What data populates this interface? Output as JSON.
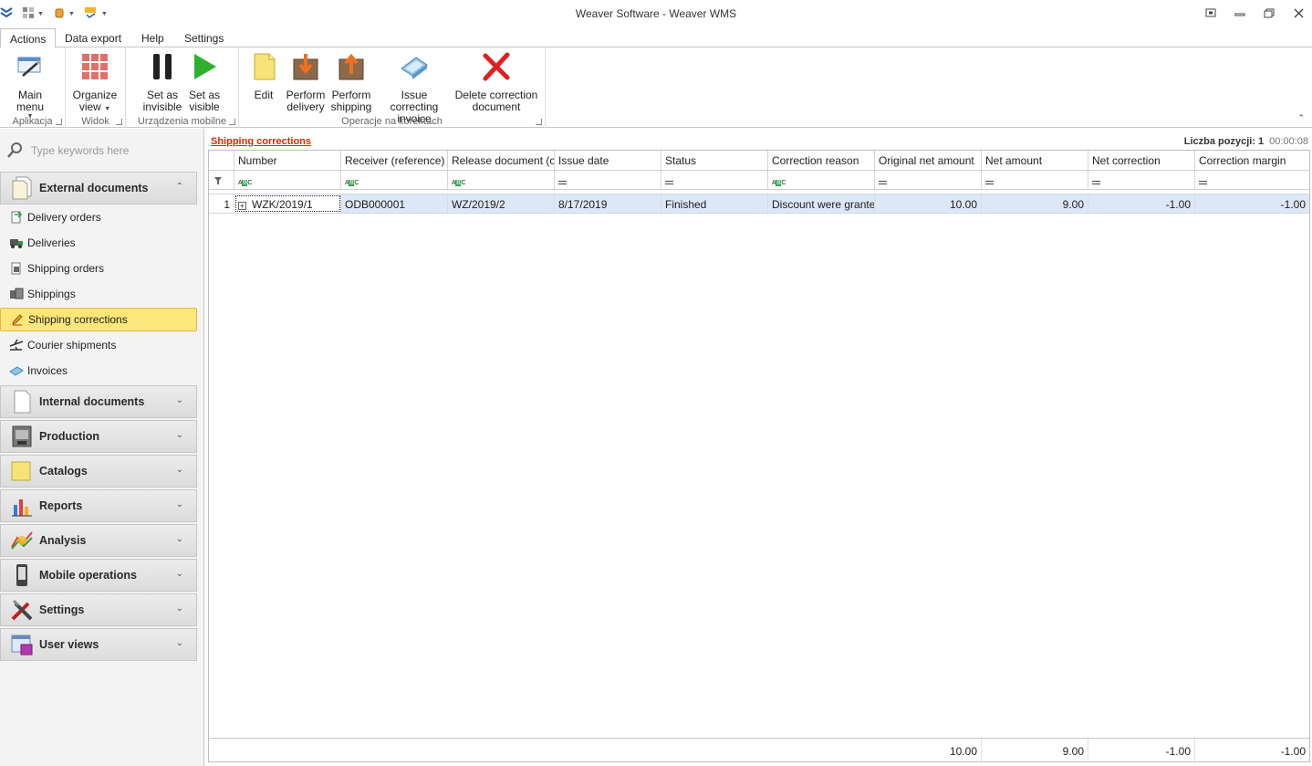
{
  "window": {
    "title": "Weaver Software - Weaver WMS"
  },
  "ribbon_tabs": [
    "Actions",
    "Data export",
    "Help",
    "Settings"
  ],
  "ribbon": {
    "groups": [
      {
        "label": "Aplikacja",
        "buttons": [
          {
            "label1": "Main menu",
            "label2": "",
            "icon": "main-menu-icon",
            "dropdown": true
          }
        ]
      },
      {
        "label": "Widok",
        "buttons": [
          {
            "label1": "Organize",
            "label2": "view",
            "icon": "organize-view-icon",
            "dropdown": true
          }
        ]
      },
      {
        "label": "Urządzenia mobilne",
        "buttons": [
          {
            "label1": "Set as",
            "label2": "invisible",
            "icon": "pause-icon"
          },
          {
            "label1": "Set as",
            "label2": "visible",
            "icon": "play-icon"
          }
        ]
      },
      {
        "label": "Operacje na korektach",
        "buttons": [
          {
            "label1": "Edit",
            "label2": "",
            "icon": "edit-icon"
          },
          {
            "label1": "Perform",
            "label2": "delivery",
            "icon": "perform-delivery-icon"
          },
          {
            "label1": "Perform",
            "label2": "shipping",
            "icon": "perform-shipping-icon"
          },
          {
            "label1": "Issue correcting",
            "label2": "invoice",
            "icon": "issue-invoice-icon"
          },
          {
            "label1": "Delete correction",
            "label2": "document",
            "icon": "delete-icon"
          }
        ]
      }
    ]
  },
  "nav": {
    "search_placeholder": "Type keywords here",
    "external_group": "External documents",
    "external_items": [
      "Delivery orders",
      "Deliveries",
      "Shipping orders",
      "Shippings",
      "Shipping corrections",
      "Courier shipments",
      "Invoices"
    ],
    "selected_item": "Shipping corrections",
    "groups": [
      "Internal documents",
      "Production",
      "Catalogs",
      "Reports",
      "Analysis",
      "Mobile operations",
      "Settings",
      "User views"
    ]
  },
  "content": {
    "title": "Shipping corrections",
    "count_label": "Liczba pozycji: 1",
    "timer": "00:00:08"
  },
  "grid": {
    "columns": [
      "Number",
      "Receiver (reference)",
      "Release document (c...",
      "Issue date",
      "Status",
      "Correction reason",
      "Original net amount",
      "Net amount",
      "Net correction",
      "Correction margin"
    ],
    "rows": [
      {
        "row_number": "1",
        "number": "WZK/2019/1",
        "receiver": "ODB000001",
        "release_document": "WZ/2019/2",
        "issue_date": "8/17/2019",
        "status": "Finished",
        "correction_reason": "Discount were granted",
        "original_net_amount": "10.00",
        "net_amount": "9.00",
        "net_correction": "-1.00",
        "correction_margin": "-1.00"
      }
    ],
    "totals": {
      "original_net_amount": "10.00",
      "net_amount": "9.00",
      "net_correction": "-1.00",
      "correction_margin": "-1.00"
    }
  },
  "colors": {
    "selection": "#fde67a",
    "row_highlight": "#dde8f6",
    "title_accent": "#d42b00"
  }
}
